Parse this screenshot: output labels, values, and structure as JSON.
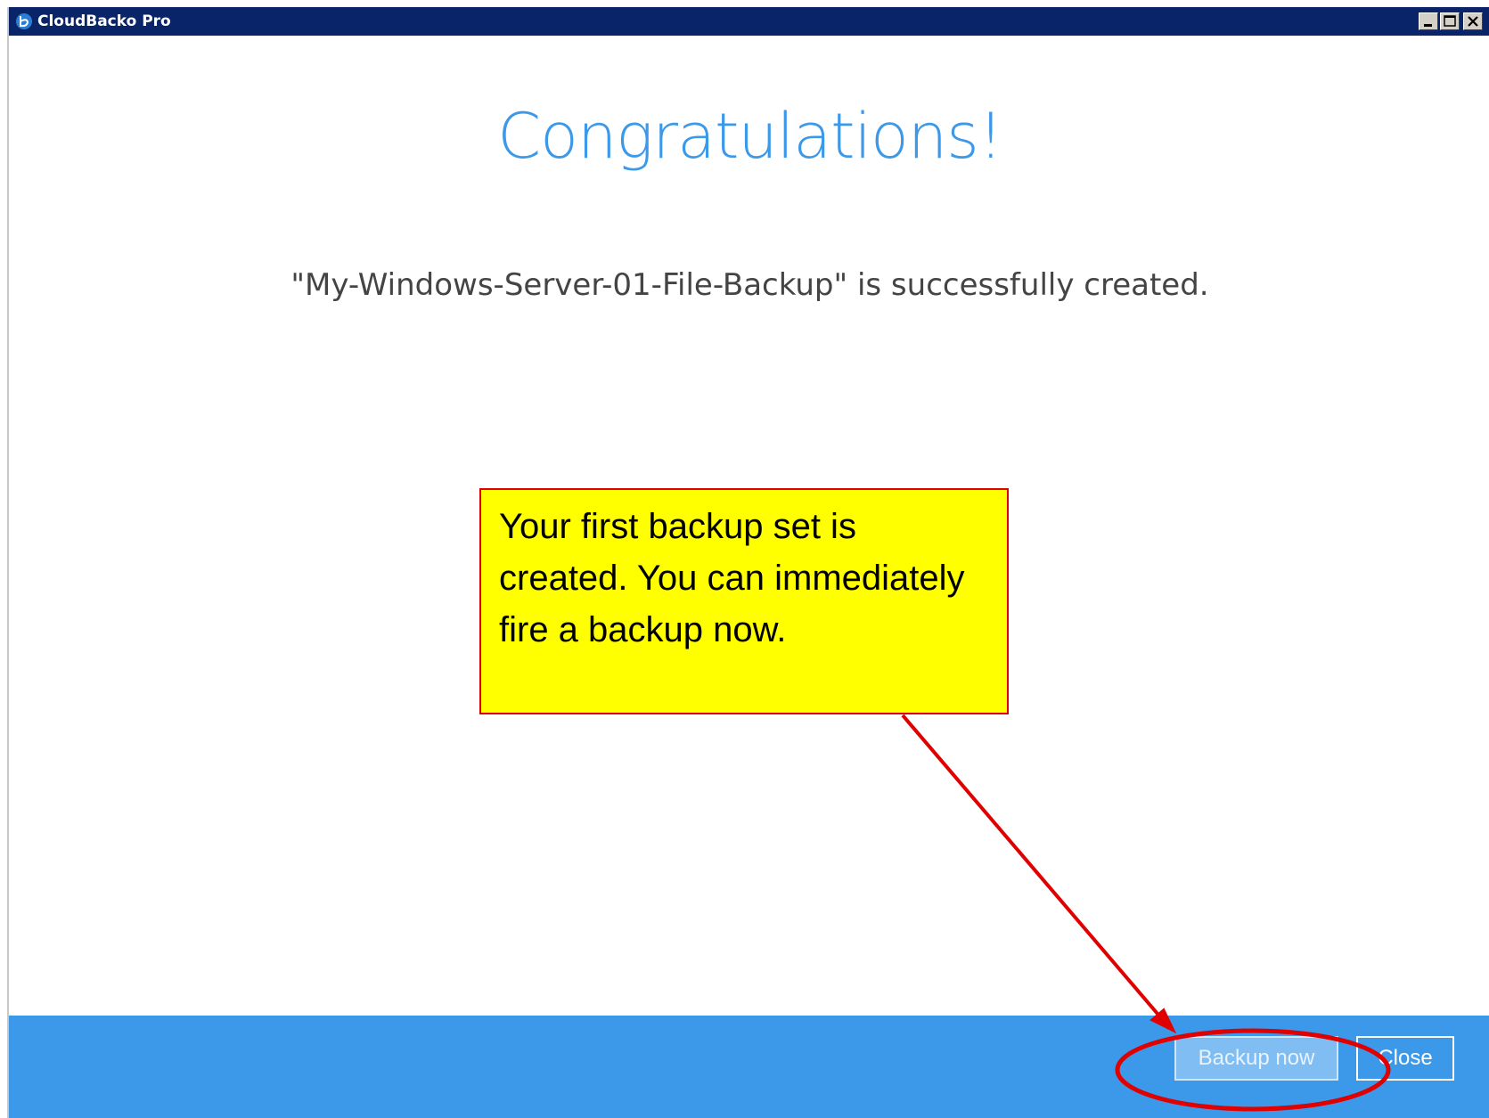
{
  "window": {
    "title": "CloudBacko Pro"
  },
  "main": {
    "heading": "Congratulations!",
    "message": "\"My-Windows-Server-01-File-Backup\" is successfully created."
  },
  "footer": {
    "backup_now_label": "Backup now",
    "close_label": "Close"
  },
  "annotation": {
    "callout_text": "Your first backup set is created. You can immediately fire a backup now.",
    "color": "#e00000",
    "callout_background": "#ffff00"
  },
  "colors": {
    "accent": "#3c98e8",
    "titlebar": "#0a246a"
  }
}
